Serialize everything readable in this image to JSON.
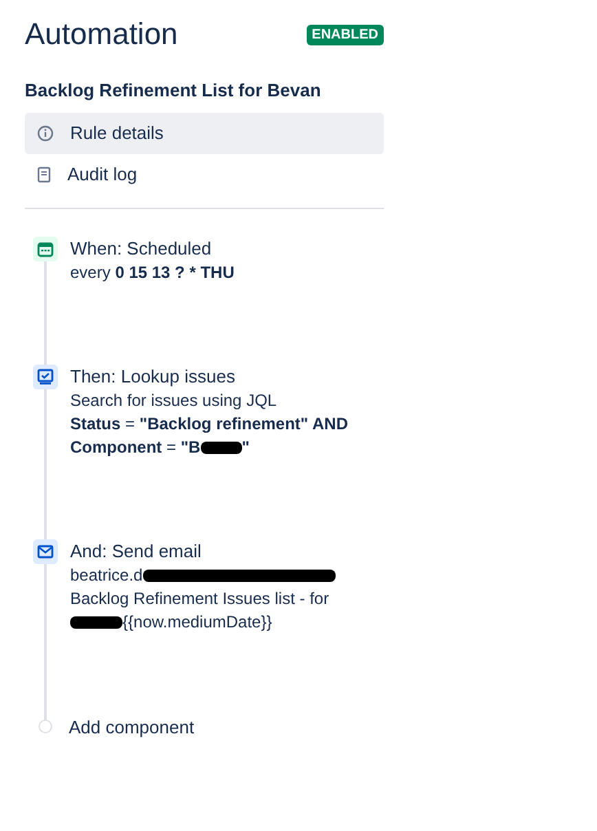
{
  "header": {
    "title": "Automation",
    "status_badge": "ENABLED"
  },
  "rule_name": "Backlog Refinement List for Bevan",
  "menu": [
    {
      "kind": "info",
      "label": "Rule details",
      "selected": true
    },
    {
      "kind": "log",
      "label": "Audit log",
      "selected": false
    }
  ],
  "steps": [
    {
      "kind": "schedule",
      "title": "When: Scheduled",
      "lines": [
        [
          {
            "text": "every **0 15 13 ? * THU**"
          }
        ]
      ]
    },
    {
      "kind": "lookup",
      "title": "Then: Lookup issues",
      "lines": [
        [
          {
            "text": "Search for issues using JQL"
          }
        ],
        [
          {
            "text": "**Status** = **\"Backlog refinement\" AND**"
          }
        ],
        [
          {
            "text": "**Component** = **\"B**"
          },
          {
            "kind": "redaction"
          },
          {
            "text": "**\"**"
          }
        ]
      ]
    },
    {
      "kind": "email",
      "title": "And: Send email",
      "lines": [
        [
          {
            "text": "beatrice.d"
          },
          {
            "kind": "redaction"
          }
        ],
        [
          {
            "text": "Backlog Refinement Issues list - for"
          }
        ],
        [
          {
            "kind": "redaction"
          },
          {
            "text": "{{now.mediumDate}}"
          }
        ]
      ]
    }
  ],
  "add_component": "Add component"
}
